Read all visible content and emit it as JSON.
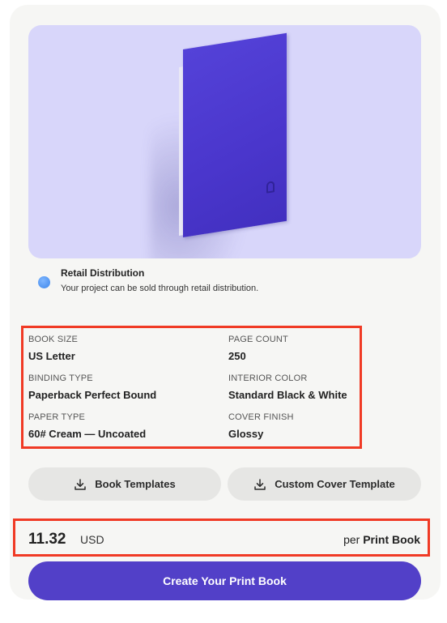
{
  "retail": {
    "title": "Retail Distribution",
    "description": "Your project can be sold through retail distribution."
  },
  "specs": {
    "book_size_label": "BOOK SIZE",
    "book_size_value": "US Letter",
    "page_count_label": "PAGE COUNT",
    "page_count_value": "250",
    "binding_type_label": "BINDING TYPE",
    "binding_type_value": "Paperback Perfect Bound",
    "interior_color_label": "INTERIOR COLOR",
    "interior_color_value": "Standard Black & White",
    "paper_type_label": "PAPER TYPE",
    "paper_type_value": "60# Cream — Uncoated",
    "cover_finish_label": "COVER FINISH",
    "cover_finish_value": "Glossy"
  },
  "templates": {
    "book_templates_label": "Book Templates",
    "custom_cover_label": "Custom Cover Template"
  },
  "price": {
    "amount": "11.32",
    "currency": "USD",
    "per_prefix": "per",
    "per_unit": "Print Book"
  },
  "cta": {
    "label": "Create Your Print Book"
  },
  "colors": {
    "accent": "#5240c8",
    "hero_bg": "#d8d6fa",
    "highlight": "#f03a25",
    "book_cover": "#4a36cc"
  },
  "icons": {
    "retail": "status-dot-icon",
    "download": "download-icon"
  }
}
